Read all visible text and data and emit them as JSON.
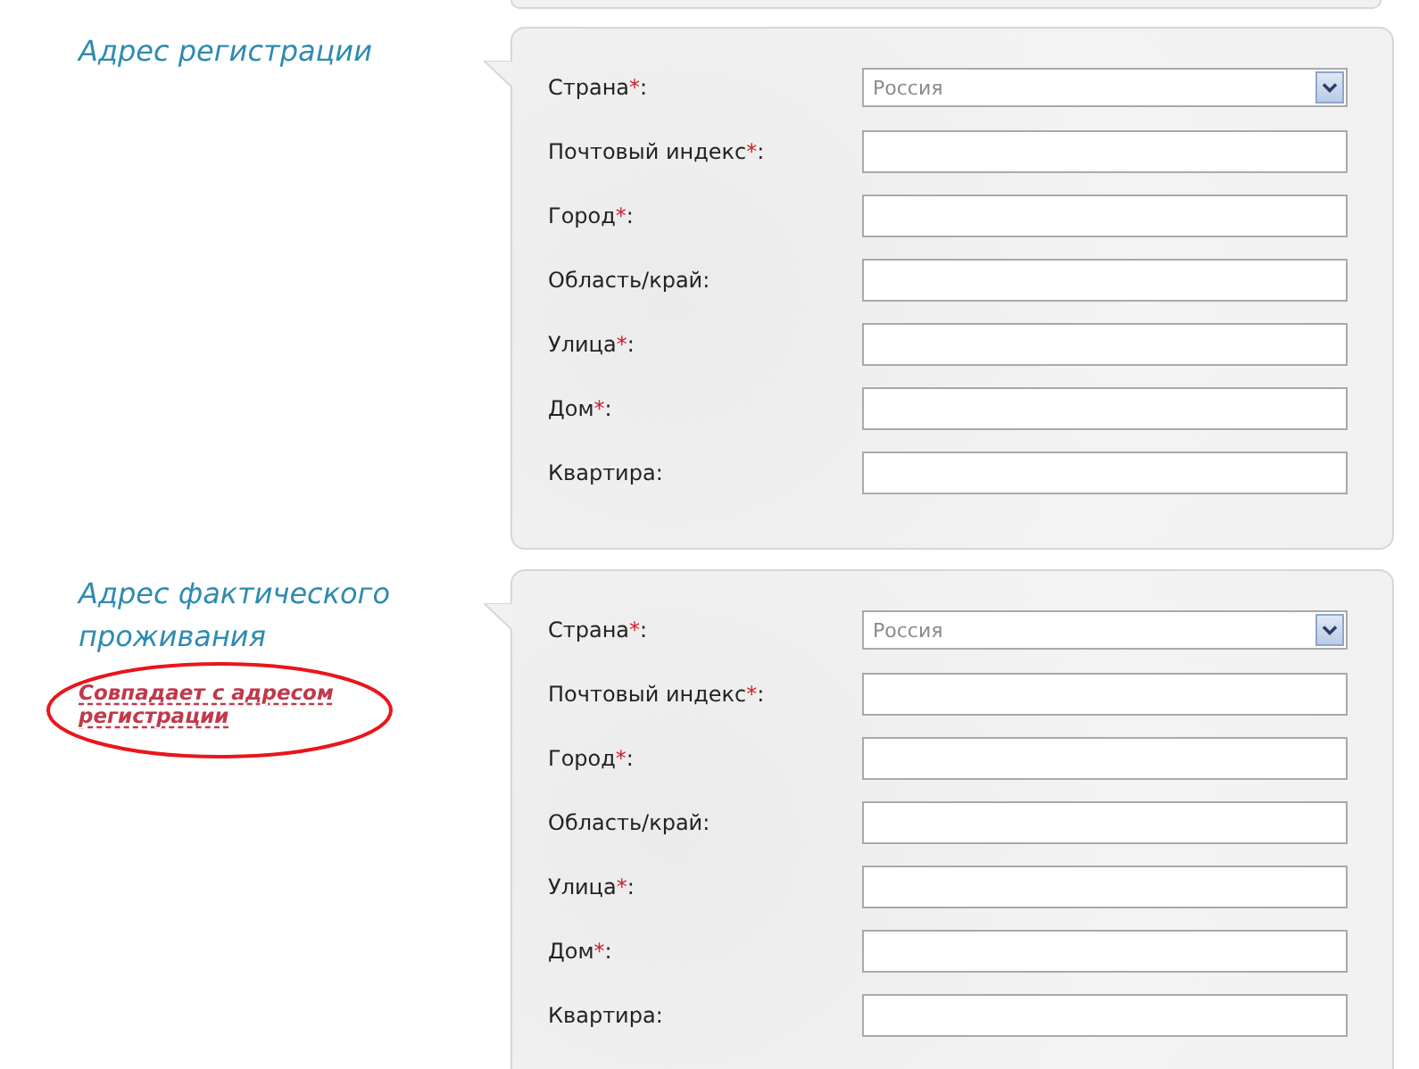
{
  "sections": [
    {
      "title": "Адрес регистрации",
      "fields": [
        {
          "label": "Страна",
          "required_mark": "*",
          "colon": ":",
          "kind": "select",
          "value": "Россия"
        },
        {
          "label": "Почтовый индекс",
          "required_mark": "*",
          "colon": ":",
          "kind": "text"
        },
        {
          "label": "Город",
          "required_mark": "*",
          "colon": ":",
          "kind": "text"
        },
        {
          "label": "Область/край",
          "colon": ":",
          "kind": "text"
        },
        {
          "label": "Улица",
          "required_mark": "*",
          "colon": ":",
          "kind": "text"
        },
        {
          "label": "Дом",
          "required_mark": "*",
          "colon": ":",
          "kind": "text"
        },
        {
          "label": "Квартира",
          "colon": ":",
          "kind": "text"
        }
      ]
    },
    {
      "title": "Адрес фактического проживания",
      "link": {
        "text": "Совпадает с адресом регистрации",
        "circled": true
      },
      "fields": [
        {
          "label": "Страна",
          "required_mark": "*",
          "colon": ":",
          "kind": "select",
          "value": "Россия"
        },
        {
          "label": "Почтовый индекс",
          "required_mark": "*",
          "colon": ":",
          "kind": "text"
        },
        {
          "label": "Город",
          "required_mark": "*",
          "colon": ":",
          "kind": "text"
        },
        {
          "label": "Область/край",
          "colon": ":",
          "kind": "text"
        },
        {
          "label": "Улица",
          "required_mark": "*",
          "colon": ":",
          "kind": "text"
        },
        {
          "label": "Дом",
          "required_mark": "*",
          "colon": ":",
          "kind": "text"
        },
        {
          "label": "Квартира",
          "colon": ":",
          "kind": "text"
        }
      ]
    }
  ]
}
